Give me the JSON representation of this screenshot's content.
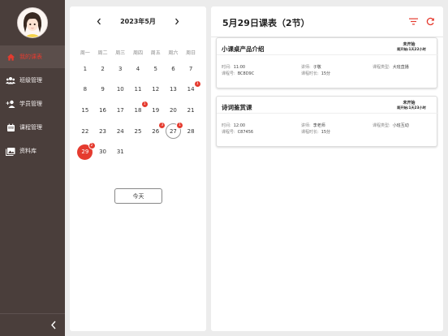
{
  "sidebar": {
    "items": [
      {
        "label": "我的课表",
        "icon": "home-icon",
        "active": true
      },
      {
        "label": "班级管理",
        "icon": "group-icon",
        "active": false
      },
      {
        "label": "学员管理",
        "icon": "add-user-icon",
        "active": false
      },
      {
        "label": "课程管理",
        "icon": "calendar-icon",
        "active": false
      },
      {
        "label": "资料库",
        "icon": "image-library-icon",
        "active": false
      }
    ],
    "collapse_icon": "chevron-left-icon"
  },
  "calendar": {
    "month_label": "2023年5月",
    "weekdays": [
      "周一",
      "周二",
      "周三",
      "周四",
      "周五",
      "周六",
      "周日"
    ],
    "days": [
      {
        "d": "1"
      },
      {
        "d": "2"
      },
      {
        "d": "3"
      },
      {
        "d": "4"
      },
      {
        "d": "5"
      },
      {
        "d": "6"
      },
      {
        "d": "7"
      },
      {
        "d": "8"
      },
      {
        "d": "9"
      },
      {
        "d": "10"
      },
      {
        "d": "11"
      },
      {
        "d": "12"
      },
      {
        "d": "13"
      },
      {
        "d": "14",
        "badge": "1"
      },
      {
        "d": "15"
      },
      {
        "d": "16"
      },
      {
        "d": "17"
      },
      {
        "d": "18",
        "badge": "1"
      },
      {
        "d": "19"
      },
      {
        "d": "20"
      },
      {
        "d": "21"
      },
      {
        "d": "22"
      },
      {
        "d": "23"
      },
      {
        "d": "24"
      },
      {
        "d": "25"
      },
      {
        "d": "26",
        "badge": "3"
      },
      {
        "d": "27",
        "badge": "1",
        "today": true
      },
      {
        "d": "28"
      },
      {
        "d": "29",
        "badge": "2",
        "selected": true
      },
      {
        "d": "30"
      },
      {
        "d": "31"
      }
    ],
    "today_button": "今天"
  },
  "schedule": {
    "title": "5月29日课表（2节）",
    "courses": [
      {
        "title": "小课桌产品介绍",
        "status": "未开始",
        "countdown": "距开始:1天22小时",
        "time_label": "时间:",
        "time": "11:00",
        "code_label": "课程号:",
        "code": "BC8D9C",
        "teacher_label": "讲师:",
        "teacher": "子敬",
        "duration_label": "课程时长:",
        "duration": "15分",
        "type_label": "课程类型:",
        "type": "大班直播"
      },
      {
        "title": "诗词鉴赏课",
        "status": "未开始",
        "countdown": "距开始:1天23小时",
        "time_label": "时间:",
        "time": "12:00",
        "code_label": "课程号:",
        "code": "C87456",
        "teacher_label": "讲师:",
        "teacher": "李老师",
        "duration_label": "课程时长:",
        "duration": "15分",
        "type_label": "课程类型:",
        "type": "小班互动"
      }
    ]
  },
  "colors": {
    "accent": "#e53b2f",
    "sidebar": "#4a3e3b"
  }
}
